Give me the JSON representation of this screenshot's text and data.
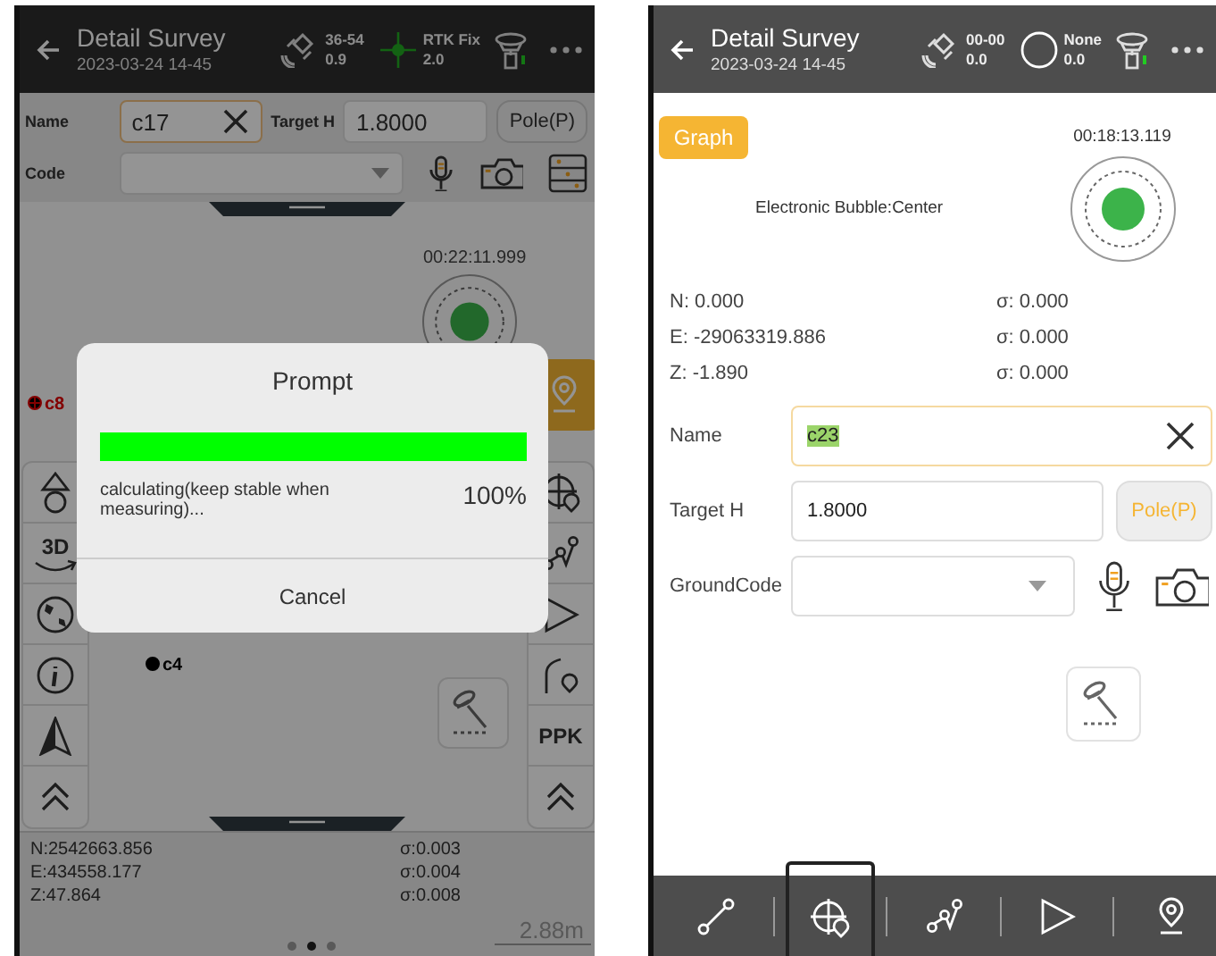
{
  "left_screen": {
    "header": {
      "title": "Detail Survey",
      "subtitle": "2023-03-24 14-45",
      "satellites": "36-54",
      "satellites_value": "0.9",
      "fix_label": "RTK Fix",
      "fix_value": "2.0"
    },
    "form": {
      "name_label": "Name",
      "name_value": "c17",
      "target_label": "Target H",
      "target_value": "1.8000",
      "pole_button": "Pole(P)",
      "code_label": "Code"
    },
    "timer": "00:22:11.999",
    "map_points": [
      {
        "label": "c8"
      },
      {
        "label": "c4"
      }
    ],
    "left_tools": [
      {
        "kind": "icon"
      },
      {
        "kind": "text",
        "label": "3D"
      },
      {
        "kind": "icon"
      },
      {
        "kind": "icon"
      },
      {
        "kind": "icon"
      },
      {
        "kind": "icon"
      }
    ],
    "right_tools": [
      {
        "kind": "icon"
      },
      {
        "kind": "icon"
      },
      {
        "kind": "icon"
      },
      {
        "kind": "icon"
      },
      {
        "kind": "text",
        "label": "PPK"
      },
      {
        "kind": "icon"
      }
    ],
    "coordinates": [
      {
        "value": "N:2542663.856",
        "sigma": "σ:0.003"
      },
      {
        "value": "E:434558.177",
        "sigma": "σ:0.004"
      },
      {
        "value": "Z:47.864",
        "sigma": "σ:0.008"
      }
    ],
    "scale": "2.88m",
    "page_dots": [
      {
        "selected": false
      },
      {
        "selected": true
      },
      {
        "selected": false
      }
    ],
    "dialog": {
      "title": "Prompt",
      "level": 1,
      "message": "calculating(keep stable when measuring)...",
      "percent": "100%",
      "cancel_button": "Cancel"
    }
  },
  "right_screen": {
    "header": {
      "title": "Detail Survey",
      "subtitle": "2023-03-24 14-45",
      "satellites": "00-00",
      "satellites_value": "0.0",
      "fix_label": "None",
      "fix_value": "0.0"
    },
    "graph_button": "Graph",
    "timer": "00:18:13.119",
    "bubble_status": "Electronic Bubble:Center",
    "coordinates": [
      {
        "value": "N: 0.000",
        "sigma": "σ: 0.000"
      },
      {
        "value": "E: -29063319.886",
        "sigma": "σ: 0.000"
      },
      {
        "value": "Z: -1.890",
        "sigma": "σ: 0.000"
      }
    ],
    "form": {
      "name_label": "Name",
      "name_value": "c23",
      "name_value_selected": true,
      "target_label": "Target H",
      "target_value": "1.8000",
      "pole_button": "Pole(P)",
      "code_label": "GroundCode"
    },
    "bottom_tabs": [
      {
        "selected": false
      },
      {
        "selected": true
      },
      {
        "selected": false
      },
      {
        "selected": false
      },
      {
        "selected": false
      }
    ]
  }
}
